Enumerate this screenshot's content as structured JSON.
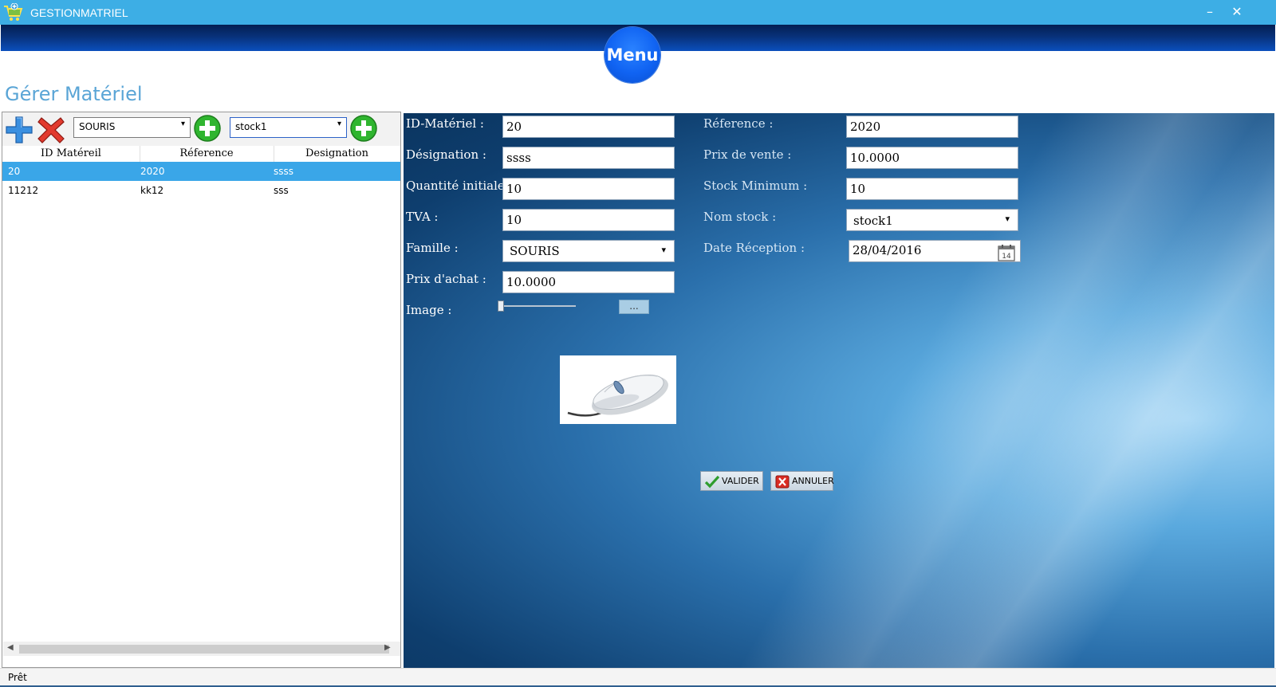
{
  "window": {
    "title": "GESTIONMATRIEL",
    "minimize": "–",
    "close": "✕"
  },
  "menu": {
    "label": "Menu"
  },
  "page_title": "Gérer Matériel",
  "toolbar": {
    "famille_combo": "SOURIS",
    "stock_combo": "stock1"
  },
  "grid": {
    "columns": [
      "ID Matéreil",
      "Réference",
      "Designation"
    ],
    "rows": [
      {
        "id": "20",
        "reference": "2020",
        "designation": "ssss",
        "selected": true
      },
      {
        "id": "11212",
        "reference": "kk12",
        "designation": "sss",
        "selected": false
      }
    ]
  },
  "form": {
    "id_label": "ID-Matériel :",
    "id_value": "20",
    "designation_label": "Désignation :",
    "designation_value": "ssss",
    "quantite_label": "Quantité initiale :",
    "quantite_value": "10",
    "tva_label": "TVA :",
    "tva_value": "10",
    "famille_label": "Famille :",
    "famille_value": "SOURIS",
    "prix_achat_label": "Prix d'achat :",
    "prix_achat_value": "10.0000",
    "image_label": "Image :",
    "browse_label": "...",
    "reference_label": "Réference :",
    "reference_value": "2020",
    "prix_vente_label": "Prix de vente :",
    "prix_vente_value": "10.0000",
    "stock_min_label": "Stock Minimum :",
    "stock_min_value": "10",
    "nom_stock_label": "Nom stock :",
    "nom_stock_value": "stock1",
    "date_label": "Date Réception :",
    "date_value": "28/04/2016",
    "calendar_day": "14",
    "image_slider_level": 0
  },
  "buttons": {
    "valider": "VALIDER",
    "annuler": "ANNULER"
  },
  "status": {
    "text": "Prêt"
  },
  "colors": {
    "titlebar": "#3daee5",
    "selection": "#3aa6e8",
    "page_title": "#5aa5d6",
    "menu_button": "#1063f2"
  }
}
